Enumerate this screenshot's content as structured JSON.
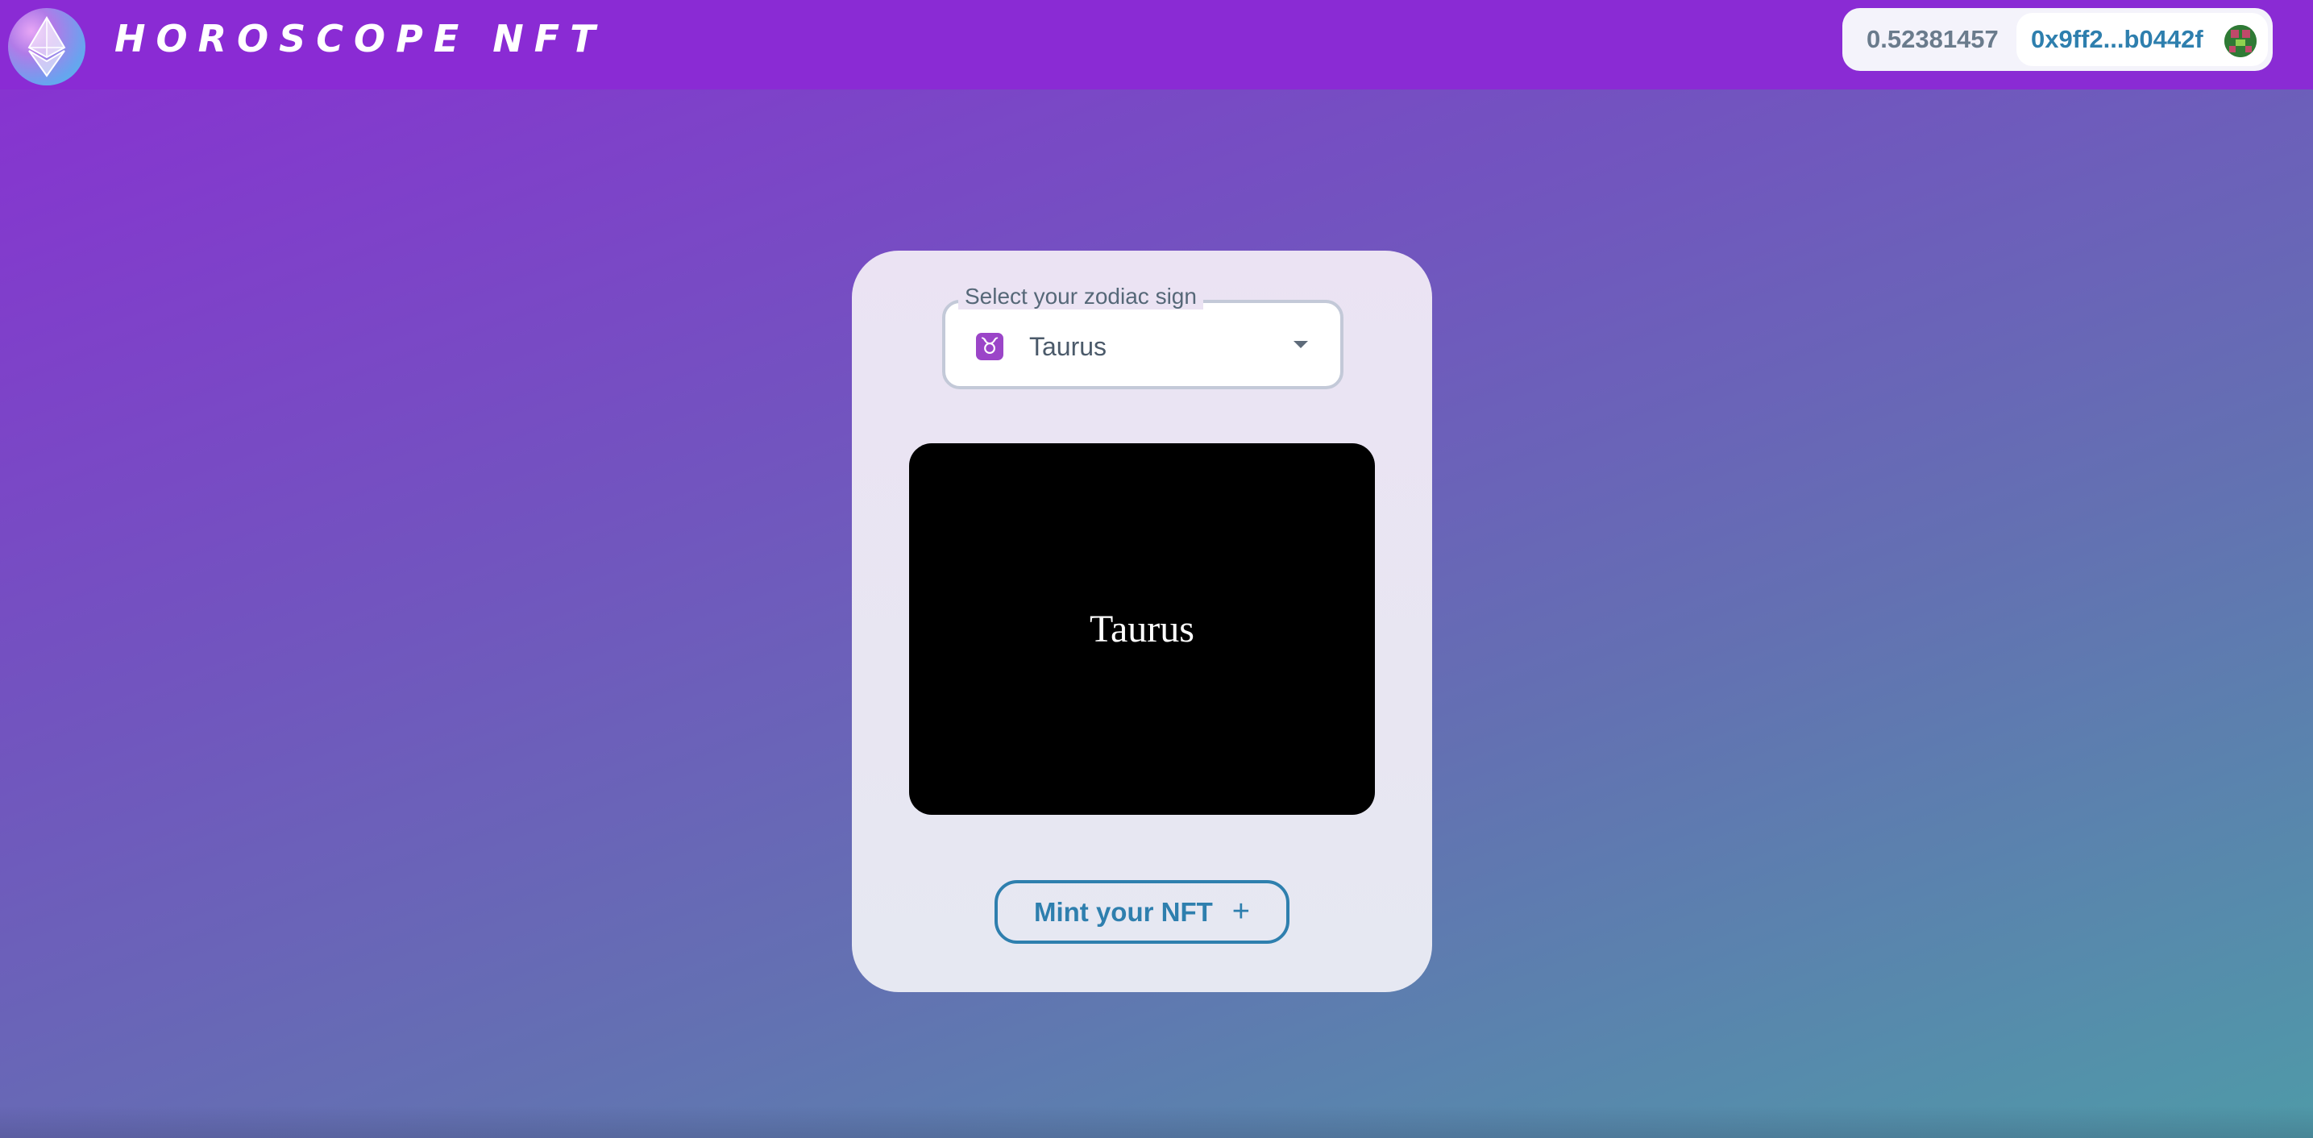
{
  "header": {
    "brand": "HOROSCOPE NFT",
    "logo_icon": "ethereum-icon"
  },
  "wallet": {
    "balance": "0.52381457",
    "address": "0x9ff2...b0442f",
    "avatar_icon": "account-avatar-icon"
  },
  "form": {
    "select_label": "Select your zodiac sign",
    "selected_sign": "Taurus",
    "selected_sign_symbol": "♉",
    "sign_icon": "taurus-icon",
    "caret_icon": "caret-down-icon"
  },
  "preview": {
    "text": "Taurus"
  },
  "mint": {
    "label": "Mint your NFT",
    "icon": "+"
  },
  "colors": {
    "header_bg": "#8a2bd4",
    "accent": "#2e7fae",
    "sign_icon_bg": "#9b45c8"
  }
}
